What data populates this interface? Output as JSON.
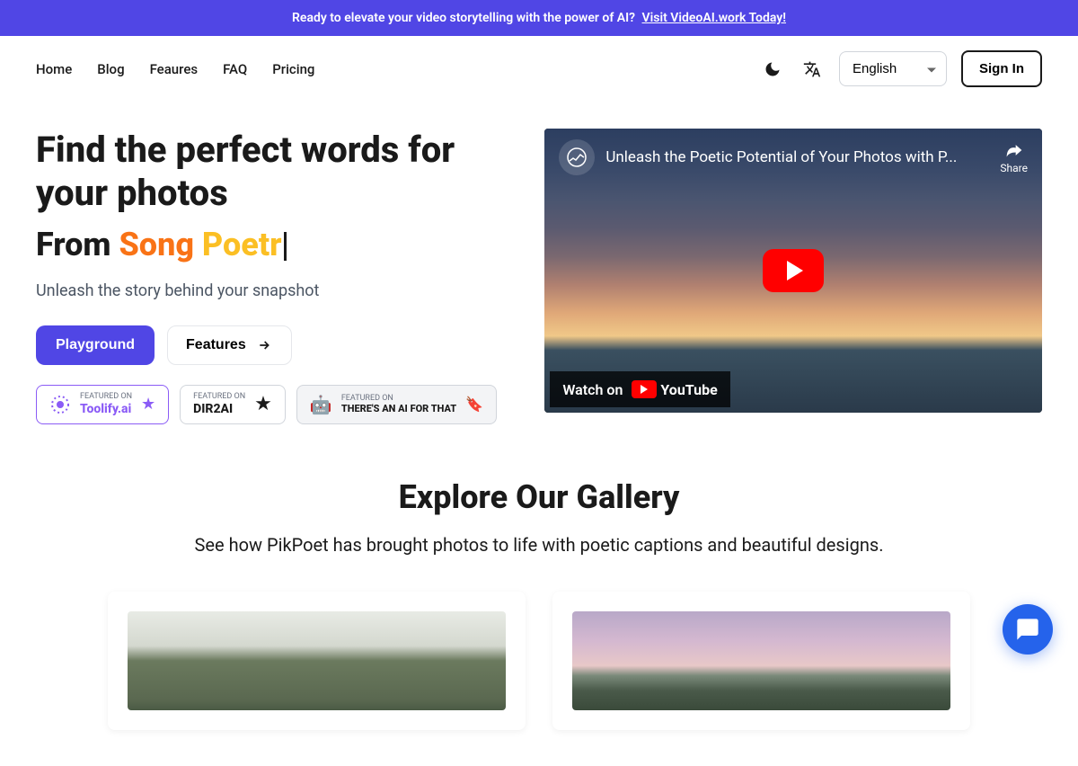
{
  "announcement": {
    "text": "Ready to elevate your video storytelling with the power of AI?",
    "link_text": "Visit VideoAI.work Today!"
  },
  "nav": {
    "links": [
      "Home",
      "Blog",
      "Feaures",
      "FAQ",
      "Pricing"
    ],
    "language": "English",
    "signin": "Sign In"
  },
  "hero": {
    "title": "Find the perfect words for your photos",
    "subtitle_from": "From ",
    "subtitle_song": "Song ",
    "subtitle_poetr": "Poetr",
    "tagline": "Unleash the story behind your snapshot",
    "playground_btn": "Playground",
    "features_btn": "Features"
  },
  "badges": [
    {
      "small": "FEATURED ON",
      "brand": "Toolify.ai"
    },
    {
      "small": "FEATURED ON",
      "brand": "DIR2AI"
    },
    {
      "small": "FEATURED ON",
      "brand": "THERE'S AN AI FOR THAT"
    }
  ],
  "video": {
    "title": "Unleash the Poetic Potential of Your Photos with P...",
    "share": "Share",
    "watch_on": "Watch on",
    "youtube": "YouTube"
  },
  "gallery": {
    "title": "Explore Our Gallery",
    "subtitle": "See how PikPoet has brought photos to life with poetic captions and beautiful designs."
  }
}
